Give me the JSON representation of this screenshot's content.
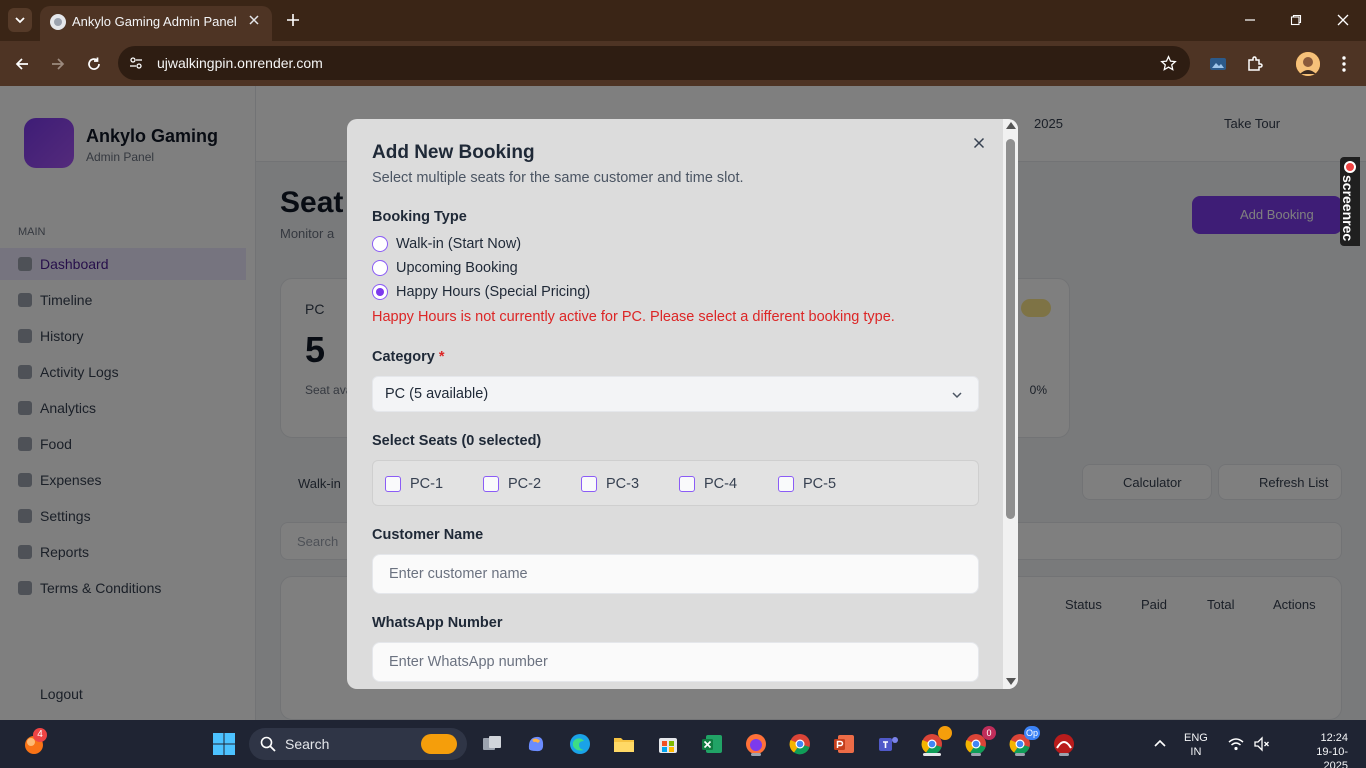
{
  "browser": {
    "tab_title": "Ankylo Gaming Admin Panel",
    "url": "ujwalkingpin.onrender.com"
  },
  "background_page": {
    "brand": "Ankylo Gaming",
    "brand_sub": "Admin Panel",
    "menu_label": "MAIN",
    "sidebar_items": [
      "Dashboard",
      "Timeline",
      "History",
      "Activity Logs",
      "Analytics",
      "Food",
      "Expenses",
      "Settings",
      "Reports",
      "Terms & Conditions"
    ],
    "logout": "Logout",
    "topbar_date": "2025",
    "topbar_take_tour": "Take Tour",
    "page_title": "Seat",
    "page_sub": "Monitor a",
    "add_booking": "Add Booking",
    "card_title": "PC",
    "card_number": "5",
    "card_desc": "Seat ava",
    "card_pct": "0%",
    "list_label": "Walk-in",
    "calculator": "Calculator",
    "refresh": "Refresh List",
    "search_placeholder": "Search",
    "table_headers": [
      "Status",
      "Paid",
      "Total",
      "Actions"
    ]
  },
  "modal": {
    "title": "Add New Booking",
    "subtitle": "Select multiple seats for the same customer and time slot.",
    "booking_type_label": "Booking Type",
    "booking_types": [
      {
        "label": "Walk-in (Start Now)",
        "checked": false
      },
      {
        "label": "Upcoming Booking",
        "checked": false
      },
      {
        "label": "Happy Hours (Special Pricing)",
        "checked": true
      }
    ],
    "error": "Happy Hours is not currently active for PC. Please select a different booking type.",
    "category_label": "Category",
    "required_mark": "*",
    "category_value": "PC (5 available)",
    "seats_label": "Select Seats (0 selected)",
    "seats": [
      "PC-1",
      "PC-2",
      "PC-3",
      "PC-4",
      "PC-5"
    ],
    "customer_name_label": "Customer Name",
    "customer_name_placeholder": "Enter customer name",
    "whatsapp_label": "WhatsApp Number",
    "whatsapp_placeholder": "Enter WhatsApp number"
  },
  "screenrec": {
    "label": "screenrec"
  },
  "taskbar": {
    "weather_badge": "4",
    "search_label": "Search",
    "chrome_badge_1": "0",
    "chrome_badge_2": "Op",
    "lang_line1": "ENG",
    "lang_line2": "IN",
    "time": "12:24",
    "date": "19-10-2025"
  },
  "colors": {
    "accent": "#7c3aed",
    "error": "#dc2626",
    "tabbar": "#3a2516",
    "toolbar": "#4e3424",
    "taskbar": "#1f2433"
  }
}
